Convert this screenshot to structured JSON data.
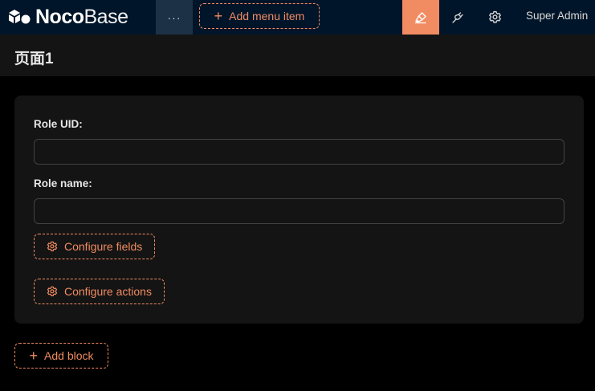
{
  "app": {
    "logo_bold": "Noco",
    "logo_light": "Base",
    "more_label": "···",
    "add_menu_label": "Add menu item",
    "user_name": "Super Admin",
    "colors": {
      "topbar": "#001529",
      "accent": "#f18b62",
      "surface": "#141414",
      "background": "#000000"
    },
    "icons": {
      "logo": "nocobase-logo-icon",
      "ui_editor": "brush-icon",
      "plugins": "plug-icon",
      "settings": "gear-icon"
    }
  },
  "page": {
    "title": "页面1"
  },
  "form": {
    "fields": [
      {
        "label": "Role UID",
        "value": "",
        "placeholder": ""
      },
      {
        "label": "Role name",
        "value": "",
        "placeholder": ""
      }
    ],
    "configure_fields_label": "Configure fields",
    "configure_actions_label": "Configure actions"
  },
  "add_block_label": "Add block"
}
